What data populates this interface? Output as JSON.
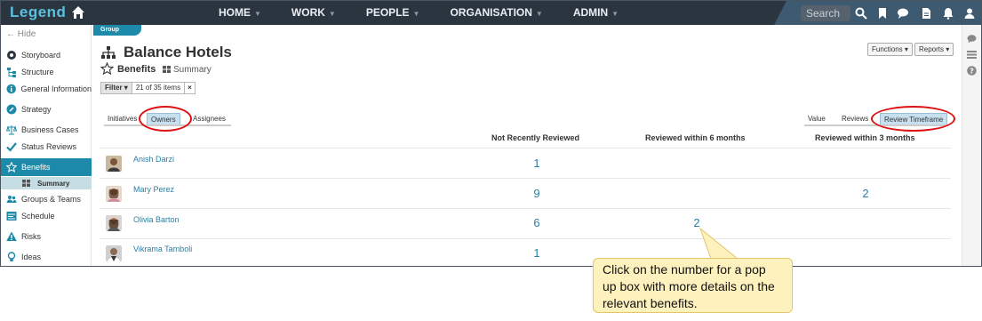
{
  "app": {
    "logo": "Legend"
  },
  "nav": [
    "HOME",
    "WORK",
    "PEOPLE",
    "ORGANISATION",
    "ADMIN"
  ],
  "search": {
    "placeholder": "Search"
  },
  "sidebar": {
    "hide_label": "Hide",
    "items": [
      {
        "label": "Storyboard",
        "icon": "storyboard-icon"
      },
      {
        "label": "Structure",
        "icon": "structure-icon"
      },
      {
        "label": "General Information",
        "icon": "info-icon"
      },
      {
        "label": "Strategy",
        "icon": "strategy-icon"
      },
      {
        "label": "Business Cases",
        "icon": "scales-icon"
      },
      {
        "label": "Status Reviews",
        "icon": "check-icon"
      },
      {
        "label": "Benefits",
        "icon": "star-icon"
      },
      {
        "label": "Groups & Teams",
        "icon": "people-icon"
      },
      {
        "label": "Schedule",
        "icon": "schedule-icon"
      },
      {
        "label": "Risks",
        "icon": "warning-icon"
      },
      {
        "label": "Ideas",
        "icon": "bulb-icon"
      }
    ],
    "sub_item": "Summary"
  },
  "group_tab": "Group",
  "page": {
    "title": "Balance Hotels",
    "section": "Benefits",
    "view_link": "Summary",
    "filter": {
      "label": "Filter",
      "count": "21 of 35 items",
      "clear": "×"
    }
  },
  "actions": {
    "functions": "Functions",
    "reports": "Reports"
  },
  "left_tabs": [
    "Initiatives",
    "Owners",
    "Assignees"
  ],
  "right_tabs": [
    "Value",
    "Reviews",
    "Review Timeframe"
  ],
  "columns": [
    "Not Recently Reviewed",
    "Reviewed within 6 months",
    "Reviewed within 3 months"
  ],
  "rows": [
    {
      "name": "Anish Darzi",
      "c1": "1",
      "c2": "",
      "c3": ""
    },
    {
      "name": "Mary Perez",
      "c1": "9",
      "c2": "",
      "c3": "2"
    },
    {
      "name": "Olivia Barton",
      "c1": "6",
      "c2": "2",
      "c3": ""
    },
    {
      "name": "Vikrama Tamboli",
      "c1": "1",
      "c2": "",
      "c3": ""
    }
  ],
  "callout": "Click on the number for a pop up box with more details on the relevant benefits.",
  "colors": {
    "accent": "#1c8aa8",
    "topbar": "#2b3540",
    "link": "#2a7fa3",
    "highlight": "#d11111"
  }
}
